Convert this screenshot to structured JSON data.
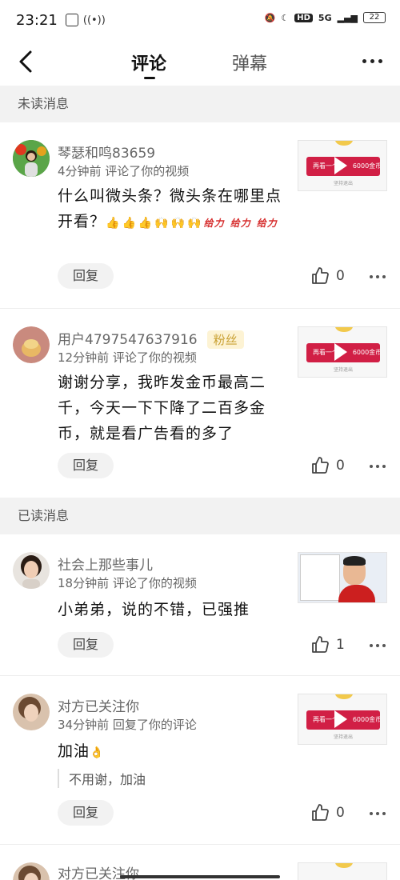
{
  "status_bar": {
    "time": "23:21",
    "network": "5G",
    "hd": "HD",
    "battery": "22"
  },
  "header": {
    "tabs": [
      {
        "label": "评论",
        "active": true
      },
      {
        "label": "弹幕",
        "active": false
      }
    ]
  },
  "sections": {
    "unread": "未读消息",
    "read": "已读消息"
  },
  "thumb_ad": {
    "button_text": "再看一个",
    "coin_text": "6000金币",
    "exit_text": "坚持退出"
  },
  "comments": [
    {
      "username": "琴瑟和鸣83659",
      "meta": "4分钟前 评论了你的视频",
      "content": "什么叫微头条？微头条在哪里点开看？",
      "emojis": [
        "👍",
        "👍",
        "👍",
        "🙌",
        "🙌",
        "🙌"
      ],
      "force_stickers": [
        "给力",
        "给力",
        "给力"
      ],
      "reply_label": "回复",
      "likes": "0"
    },
    {
      "username": "用户4797547637916",
      "badge": "粉丝",
      "meta": "12分钟前 评论了你的视频",
      "content": "谢谢分享，我昨发金币最高二千，今天一下下降了二百多金币，就是看广告看的多了",
      "reply_label": "回复",
      "likes": "0"
    },
    {
      "username": "社会上那些事儿",
      "meta": "18分钟前 评论了你的视频",
      "content": "小弟弟，说的不错，已强推",
      "reply_label": "回复",
      "likes": "1"
    },
    {
      "username": "对方已关注你",
      "meta": "34分钟前 回复了你的评论",
      "content": "加油",
      "content_emoji": "👌",
      "quote": "不用谢，加油",
      "reply_label": "回复",
      "likes": "0"
    },
    {
      "username": "对方已关注你"
    }
  ]
}
